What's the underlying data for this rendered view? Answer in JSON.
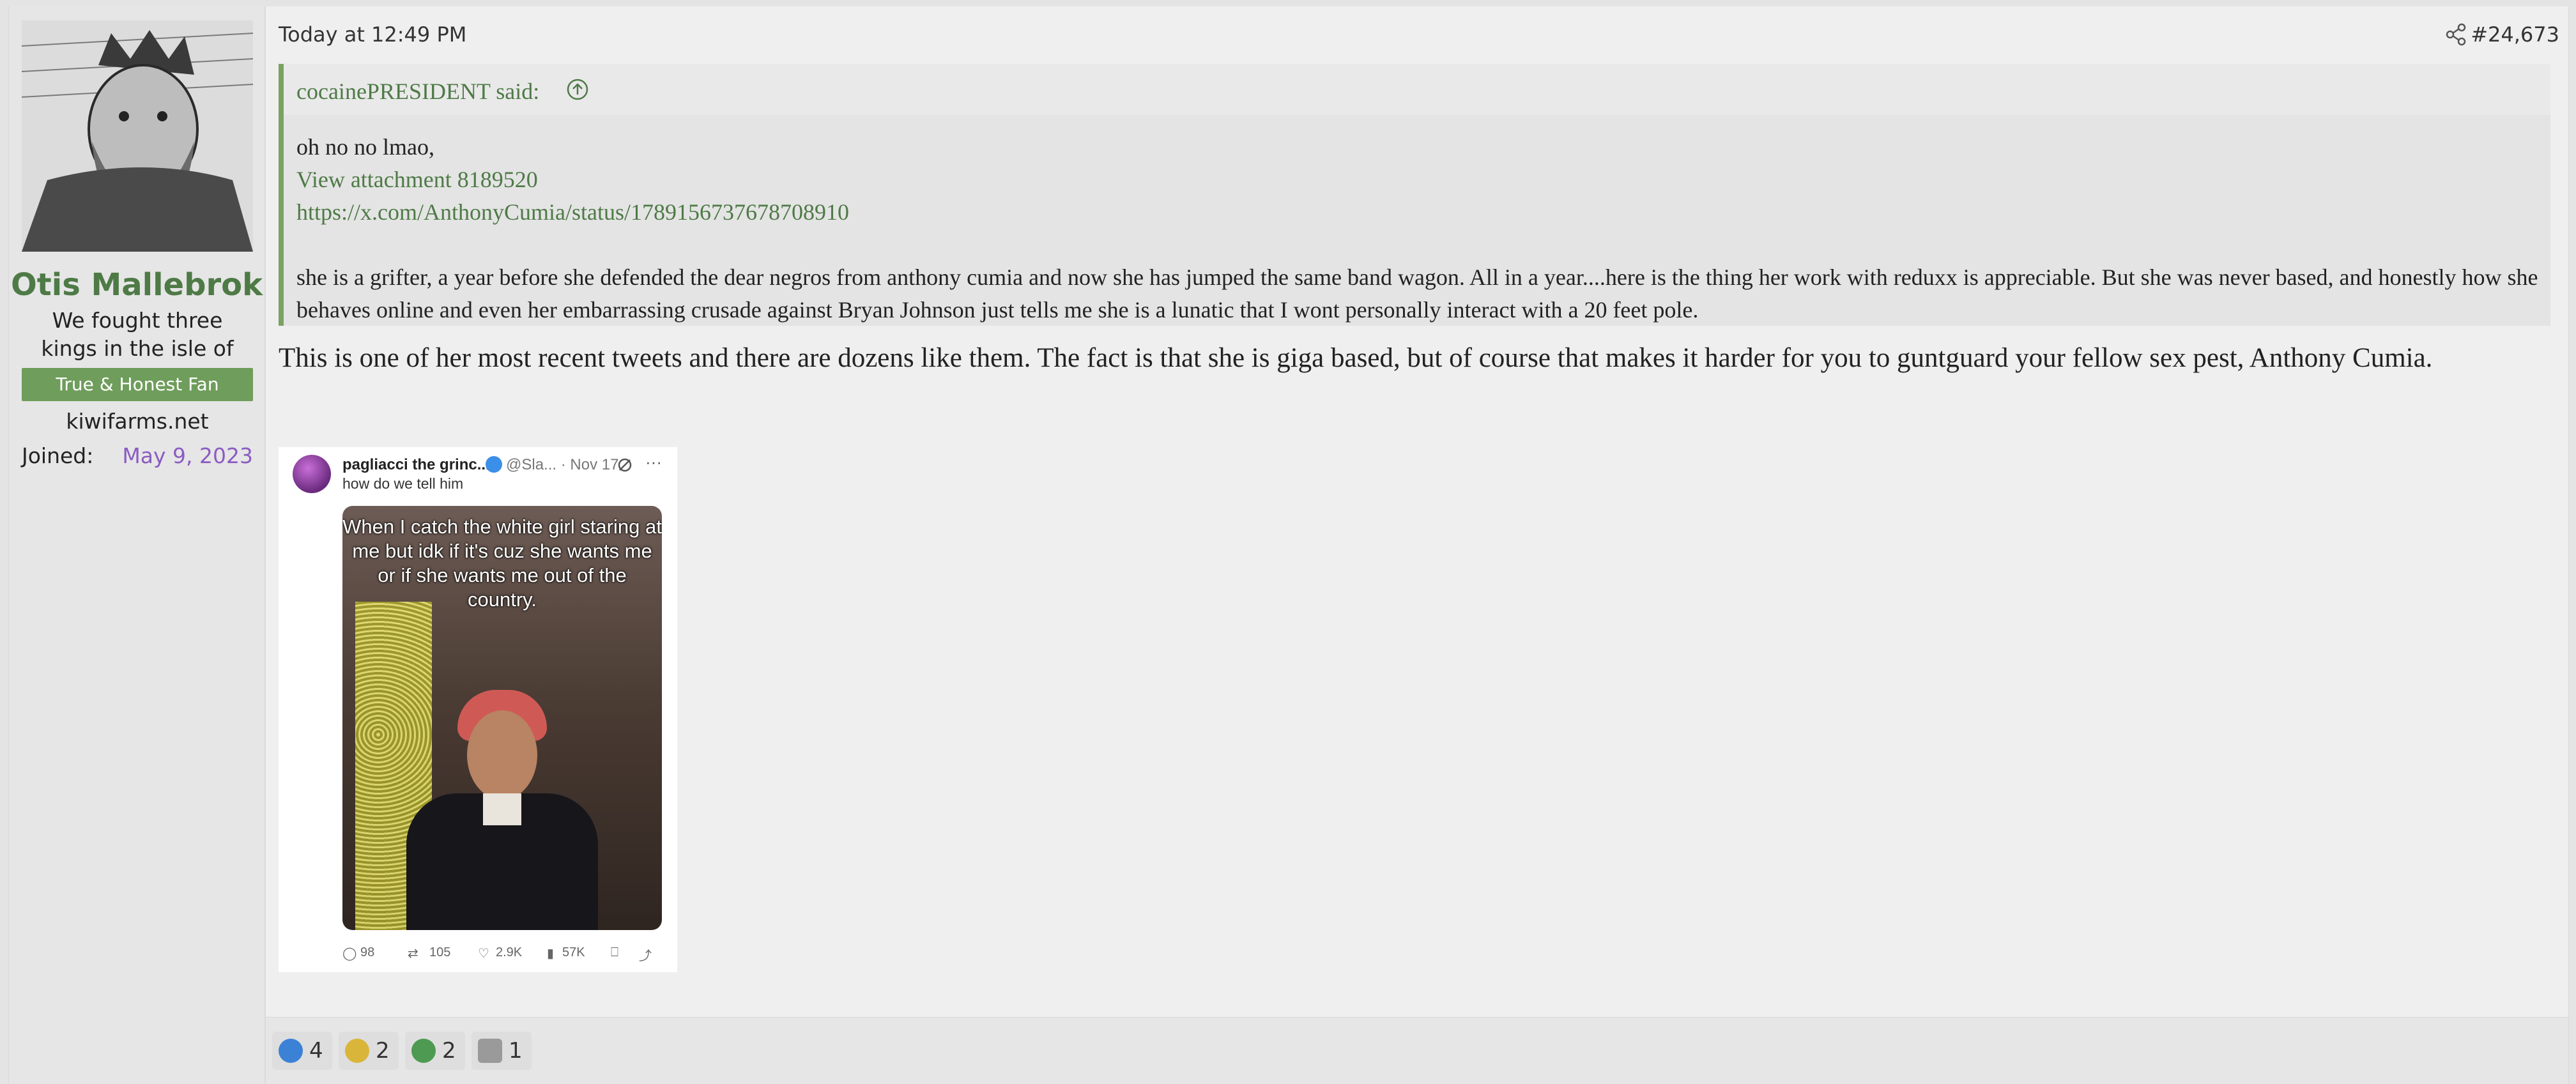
{
  "user": {
    "name": "Otis Mallebrok",
    "title": "We fought three kings in the isle of Lindis",
    "banner": "True & Honest Fan",
    "site": "kiwifarms.net",
    "joined_label": "Joined:",
    "joined_date": "May 9, 2023"
  },
  "post": {
    "date": "Today at 12:49 PM",
    "number": "#24,673",
    "quote": {
      "author": "cocainePRESIDENT said:",
      "line1": "oh no no lmao,",
      "attachment_link": "View attachment 8189520",
      "url_link": "https://x.com/AnthonyCumia/status/1789156737678708910",
      "paragraph": "she is a grifter, a year before she defended the dear negros from anthony cumia and now she has jumped the same band wagon. All in a year....here is the thing her work with reduxx is appreciable. But she was never based, and honestly how she behaves online and even her embarrassing crusade against Bryan Johnson just tells me she is a lunatic that I wont personally interact with a 20 feet pole."
    },
    "body": "This is one of her most recent tweets and there are dozens like them. The fact is that she is giga based, but of course that makes it harder for you to guntguard your fellow sex pest, Anthony Cumia.",
    "attachment": {
      "display_name": "pagliacci the grinc...",
      "handle": "@Sla... · Nov 17",
      "text": "how do we tell him",
      "caption": "When I catch the white girl staring at me but idk if it's cuz she wants me or if she wants me out of the country.",
      "replies": "98",
      "reposts": "105",
      "likes": "2.9K",
      "views": "57K"
    }
  },
  "reactions": [
    {
      "icon": "thumbs-up-icon",
      "count": "4",
      "color": "#3b82d6"
    },
    {
      "icon": "medal-icon",
      "count": "2",
      "color": "#d9b53a"
    },
    {
      "icon": "check-icon",
      "count": "2",
      "color": "#4e9a52"
    },
    {
      "icon": "trash-can-icon",
      "count": "1",
      "color": "#9a9a9a"
    }
  ]
}
